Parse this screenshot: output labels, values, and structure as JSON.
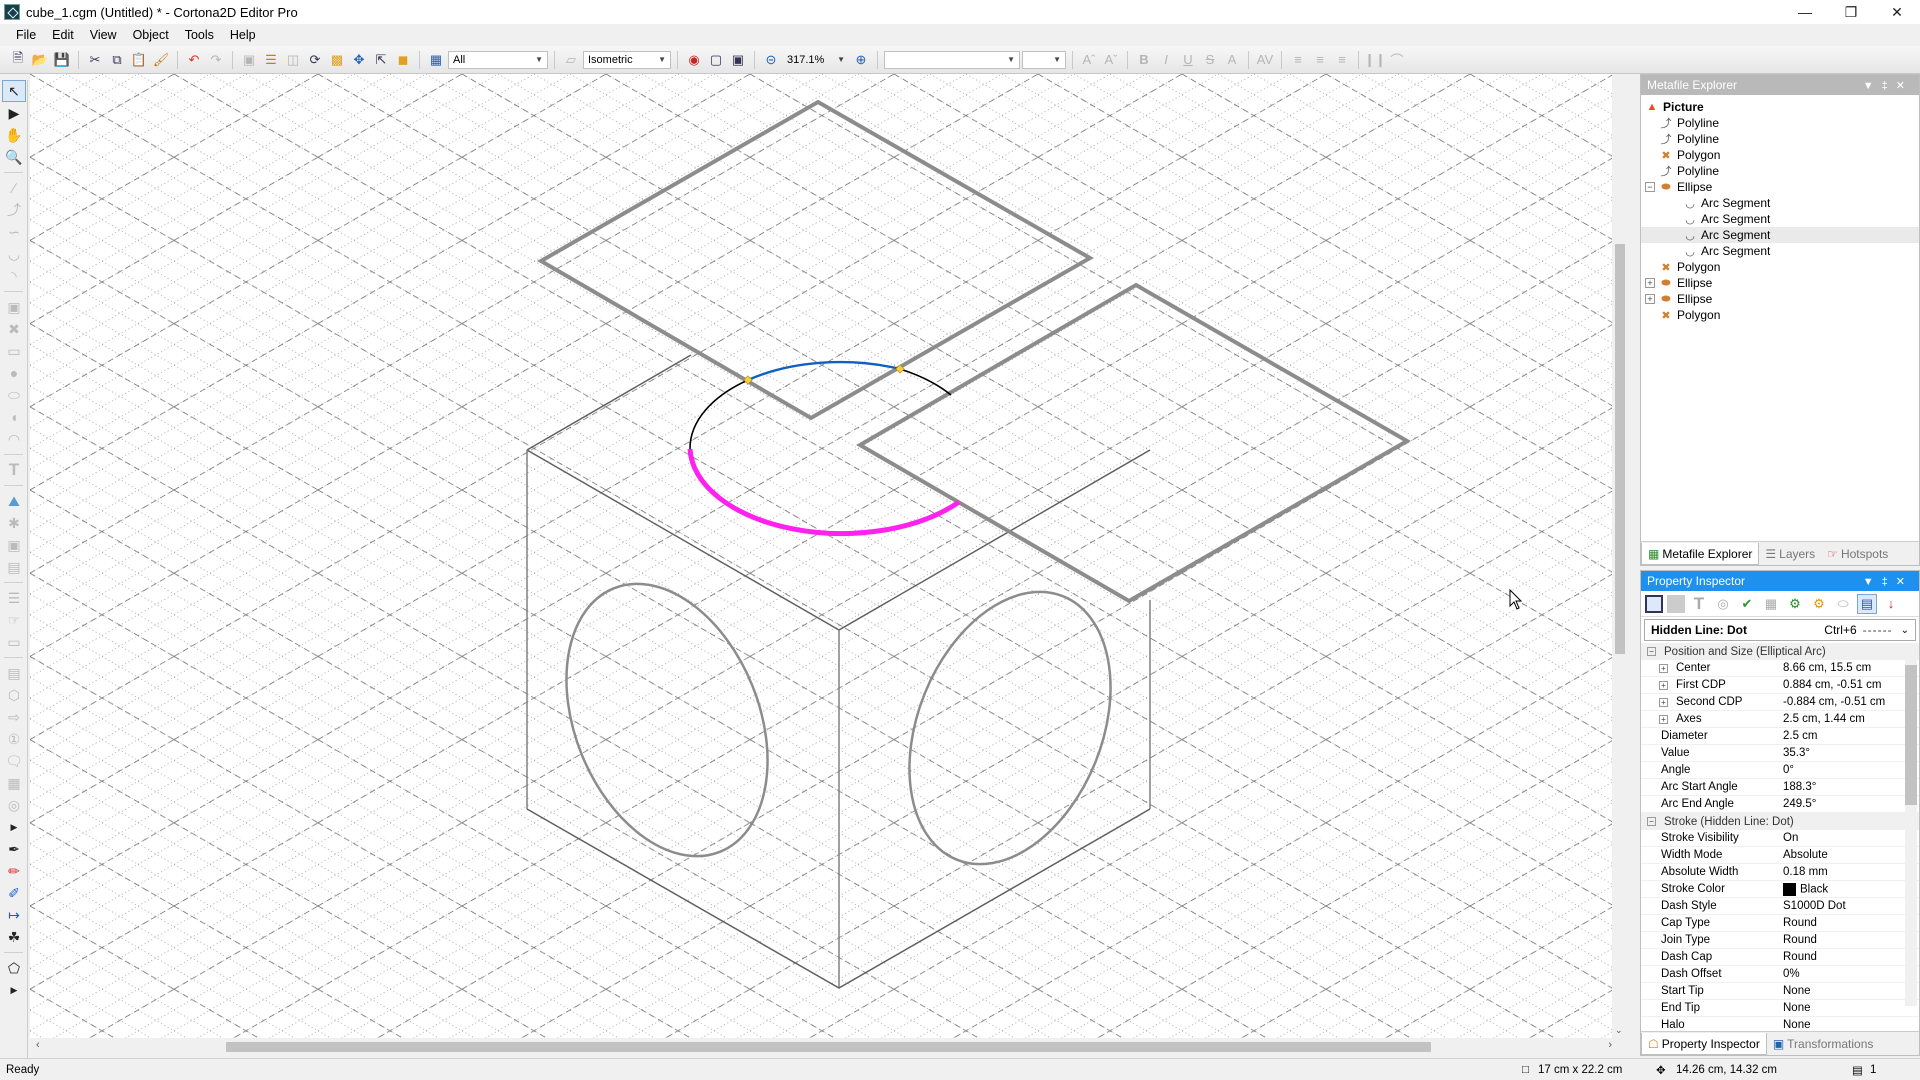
{
  "window": {
    "title": "cube_1.cgm (Untitled) * - Cortona2D Editor Pro",
    "controls": [
      "minimize",
      "restore",
      "close"
    ]
  },
  "menu": [
    "File",
    "Edit",
    "View",
    "Object",
    "Tools",
    "Help"
  ],
  "toolbar": {
    "layer_filter": "All",
    "projection": "Isometric",
    "zoom_level": "317.1%",
    "font_name": "",
    "font_size": ""
  },
  "metafile_explorer": {
    "title": "Metafile Explorer",
    "root": "Picture",
    "items": [
      {
        "label": "Polyline",
        "type": "polyline",
        "depth": 1
      },
      {
        "label": "Polyline",
        "type": "polyline",
        "depth": 1
      },
      {
        "label": "Polygon",
        "type": "polygon",
        "depth": 1
      },
      {
        "label": "Polyline",
        "type": "polyline",
        "depth": 1
      },
      {
        "label": "Ellipse",
        "type": "ellipse",
        "depth": 1,
        "expander": "minus"
      },
      {
        "label": "Arc Segment",
        "type": "arc",
        "depth": 2
      },
      {
        "label": "Arc Segment",
        "type": "arc",
        "depth": 2
      },
      {
        "label": "Arc Segment",
        "type": "arc",
        "depth": 2,
        "selected": true
      },
      {
        "label": "Arc Segment",
        "type": "arc",
        "depth": 2
      },
      {
        "label": "Polygon",
        "type": "polygon",
        "depth": 1
      },
      {
        "label": "Ellipse",
        "type": "ellipse",
        "depth": 1,
        "expander": "plus"
      },
      {
        "label": "Ellipse",
        "type": "ellipse",
        "depth": 1,
        "expander": "plus"
      },
      {
        "label": "Polygon",
        "type": "polygon",
        "depth": 1
      }
    ],
    "tabs": [
      "Metafile Explorer",
      "Layers",
      "Hotspots"
    ]
  },
  "property_inspector": {
    "title": "Property Inspector",
    "style_name": "Hidden Line: Dot",
    "style_shortcut": "Ctrl+6",
    "group1": "Position and Size (Elliptical Arc)",
    "rows1": [
      {
        "k": "Center",
        "v": "8.66 cm, 15.5 cm",
        "expandable": true
      },
      {
        "k": "First CDP",
        "v": "0.884 cm, -0.51 cm",
        "expandable": true
      },
      {
        "k": "Second CDP",
        "v": "-0.884 cm, -0.51 cm",
        "expandable": true
      },
      {
        "k": "Axes",
        "v": "2.5 cm, 1.44 cm",
        "expandable": true
      },
      {
        "k": "Diameter",
        "v": "2.5 cm"
      },
      {
        "k": "Value",
        "v": "35.3°"
      },
      {
        "k": "Angle",
        "v": "0°"
      },
      {
        "k": "Arc Start Angle",
        "v": "188.3°"
      },
      {
        "k": "Arc End Angle",
        "v": "249.5°"
      }
    ],
    "group2": "Stroke (Hidden Line: Dot)",
    "rows2": [
      {
        "k": "Stroke Visibility",
        "v": "On"
      },
      {
        "k": "Width Mode",
        "v": "Absolute"
      },
      {
        "k": "Absolute Width",
        "v": "0.18 mm"
      },
      {
        "k": "Stroke Color",
        "v": "Black",
        "swatch": "#000000"
      },
      {
        "k": "Dash Style",
        "v": "S1000D Dot"
      },
      {
        "k": "Cap Type",
        "v": "Round"
      },
      {
        "k": "Join Type",
        "v": "Round"
      },
      {
        "k": "Dash Cap",
        "v": "Round"
      },
      {
        "k": "Dash Offset",
        "v": "0%"
      },
      {
        "k": "Start Tip",
        "v": "None"
      },
      {
        "k": "End Tip",
        "v": "None"
      },
      {
        "k": "Halo",
        "v": "None"
      }
    ],
    "tabs": [
      "Property Inspector",
      "Transformations"
    ]
  },
  "status": {
    "text": "Ready",
    "page_size": "17 cm x 22.2 cm",
    "cursor": "14.26 cm, 14.32 cm",
    "pages": "1"
  },
  "colors": {
    "selection_magenta": "#ff22ee",
    "arc_blue": "#1060c0",
    "panel_header_blue": "#1e90ee",
    "shape_gray": "#8c8c8c"
  }
}
